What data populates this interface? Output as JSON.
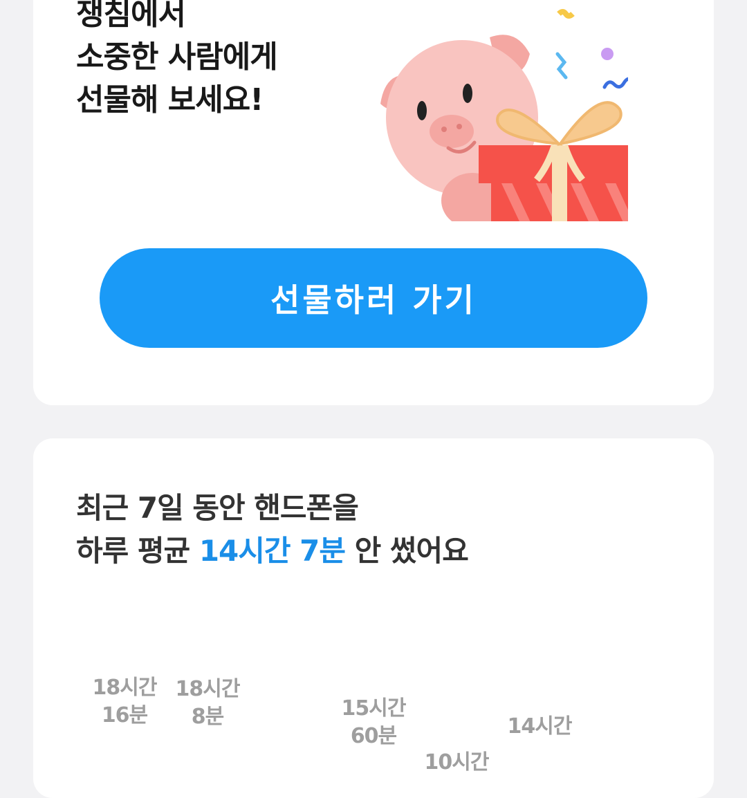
{
  "promo": {
    "heading_lines": [
      "쟁침에서",
      "소중한 사람에게",
      "선물해 보세요!"
    ],
    "button_label": "선물하러 가기"
  },
  "usage": {
    "heading_line1": "최근 7일 동안 핸드폰을",
    "heading_line2_prefix": "하루 평균",
    "heading_line2_highlight": "14시간 7분",
    "heading_line2_suffix": "안 썼어요"
  },
  "chart_data": {
    "type": "bar",
    "categories": [],
    "labels": [
      {
        "hours": "18시간",
        "minutes": "16분"
      },
      {
        "hours": "18시간",
        "minutes": "8분"
      },
      {
        "hours": "",
        "minutes": ""
      },
      {
        "hours": "15시간",
        "minutes": "60분"
      },
      {
        "hours": "10시간",
        "minutes": ""
      },
      {
        "hours": "14시간",
        "minutes": ""
      },
      {
        "hours": "",
        "minutes": ""
      }
    ],
    "values_minutes": [
      1096,
      1088,
      null,
      960,
      600,
      840,
      null
    ]
  },
  "colors": {
    "accent": "#1a9af7",
    "highlight_text": "#1a8ee8",
    "gift_box": "#f5524a",
    "pig": "#f9c4c0"
  }
}
